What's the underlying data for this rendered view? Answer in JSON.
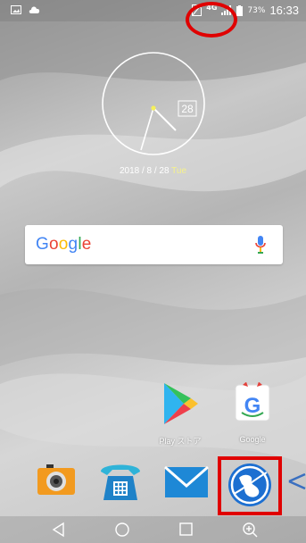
{
  "status_bar": {
    "network_type": "4G",
    "battery_percent": "73%",
    "time": "16:33"
  },
  "clock_widget": {
    "date_badge": "28",
    "date": "2018 / 8 / 28",
    "weekday": "Tue"
  },
  "search": {
    "logo_text": "Google",
    "logo_colors": [
      "#4285F4",
      "#EA4335",
      "#FBBC05",
      "#4285F4",
      "#34A853",
      "#EA4335"
    ]
  },
  "home_apps": [
    {
      "label": "Play ストア",
      "icon": "play-store-icon"
    },
    {
      "label": "Google",
      "icon": "google-folder-icon"
    }
  ],
  "dock": [
    {
      "icon": "camera-icon"
    },
    {
      "icon": "phone-icon"
    },
    {
      "icon": "email-icon"
    },
    {
      "icon": "browser-globe-icon"
    }
  ],
  "navigation": [
    "back-icon",
    "home-icon",
    "recents-icon",
    "zoom-in-icon"
  ],
  "annotations": {
    "highlight_color": "#e00000",
    "arrow_color": "#3a6fc0"
  }
}
